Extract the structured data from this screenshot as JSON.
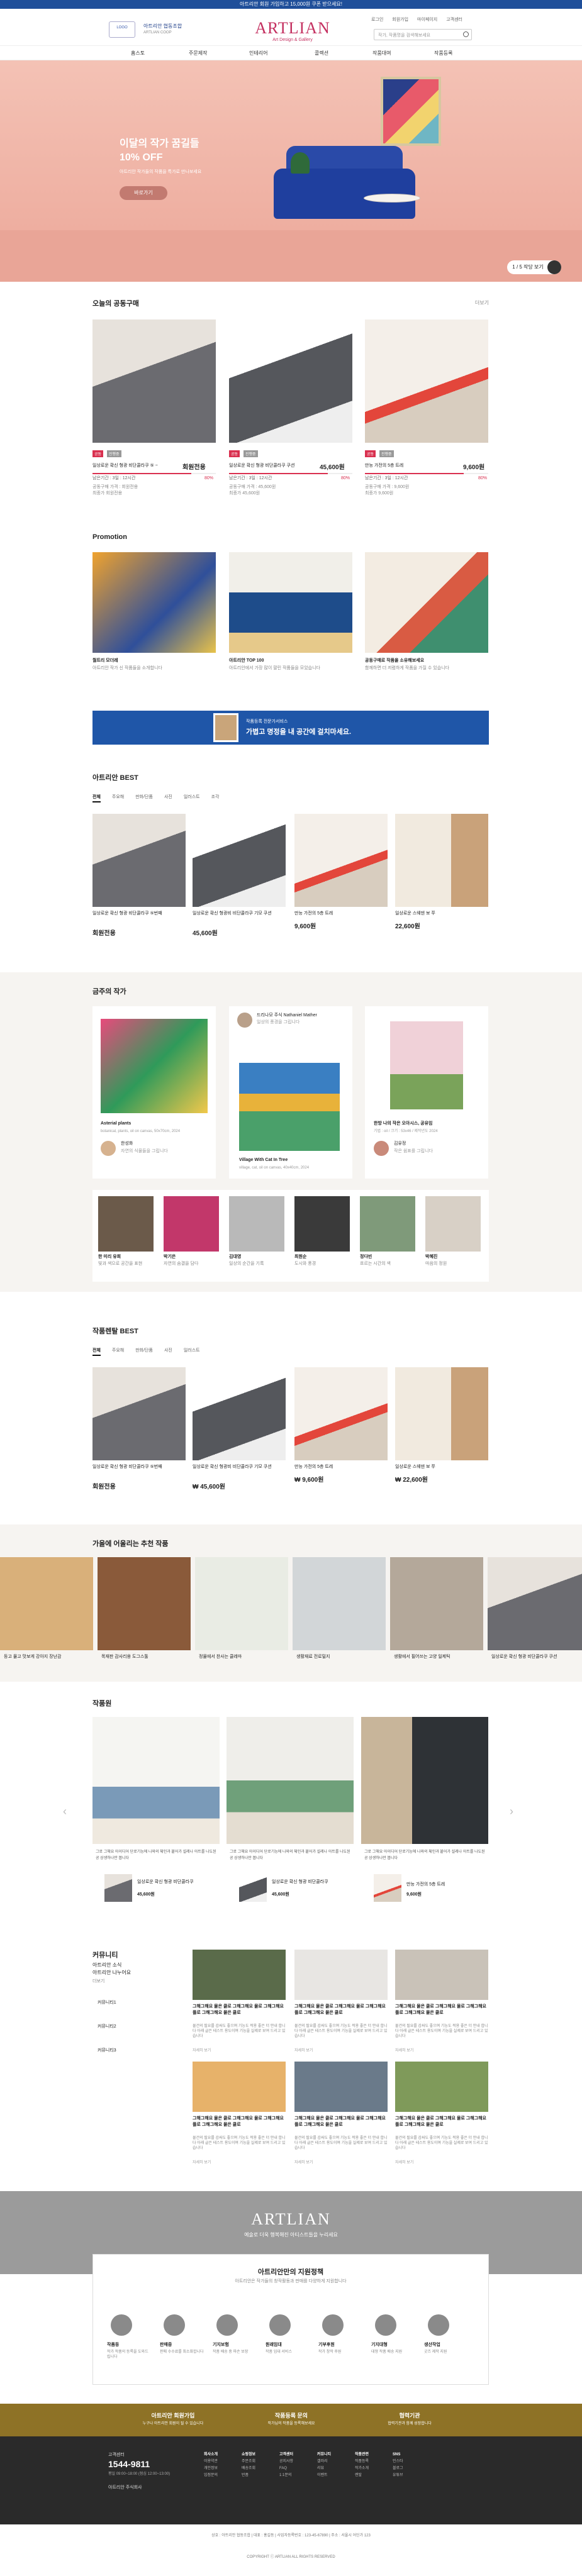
{
  "topbar": {
    "text": "아트리안 회원 가입하고 15,000원 쿠폰 받으세요!"
  },
  "util": [
    "로그인",
    "회원가입",
    "마이페이지",
    "고객센터"
  ],
  "logo_left": {
    "mark": "LOGO",
    "name": "아트리안 협동조합",
    "sub": "ARTLIAN COOP"
  },
  "brand": {
    "name": "ARTLIAN",
    "sub": "Art Design & Gallery"
  },
  "search": {
    "placeholder": "작가, 작품명을 검색해보세요"
  },
  "nav": [
    "홈스토",
    "주문제작",
    "인테리어",
    "콜렉션",
    "작품대여",
    "작품등록"
  ],
  "hero": {
    "title1": "이달의 작가 꿈길들",
    "title2": "10% OFF",
    "sub": "아트리안 작가들의 작품을 특가로 만나보세요",
    "button": "바로가기",
    "page": "1 / 5 작당 보기"
  },
  "group": {
    "title": "오늘의 공동구매",
    "more": "더보기",
    "items": [
      {
        "tag1": "공동",
        "tag2": "진행중",
        "name": "일상로운 확신 형광 비단콜라쿠 ⑤ ~",
        "price": "회원전용",
        "ratio": "80%",
        "date": "남은기간 : 3일 : 12시간",
        "l1": "공동구매 가격 : 회원전용",
        "l2": "최종가 회원전용"
      },
      {
        "tag1": "공동",
        "tag2": "진행중",
        "name": "일상로운 확신 형광 비단콜라쿠 쿠션",
        "price": "45,600원",
        "ratio": "80%",
        "date": "남은기간 : 3일 : 12시간",
        "l1": "공동구매 가격 : 45,600원",
        "l2": "최종가 45,600원"
      },
      {
        "tag1": "공동",
        "tag2": "진행중",
        "name": "만능 가전의 5층 트레",
        "price": "9,600원",
        "ratio": "80%",
        "date": "남은기간 : 3일 : 12시간",
        "l1": "공동구매 가격 : 9,600원",
        "l2": "최종가 9,600원"
      }
    ]
  },
  "promo": {
    "title": "Promotion",
    "items": [
      {
        "t1": "월트리 모더레",
        "t2": "아트리안 작가 신 작품들을 소개합니다"
      },
      {
        "t1": "아트리안 TOP 100",
        "t2": "아트리안에서 가장 많이 팔린 작품들을 모았습니다"
      },
      {
        "t1": "공동구매로 작품을 소유해보세요",
        "t2": "함께하면 더 저렴하게 작품을 가질 수 있습니다"
      }
    ]
  },
  "banner": {
    "text1": "작품등록 전문가서비스",
    "text2": "가볍고 명정을 내 공간에 걸치마세요."
  },
  "best": {
    "title": "아트리안 BEST",
    "tabs": [
      "전체",
      "주요해",
      "판화/단품",
      "사진",
      "일러스트",
      "조각"
    ],
    "items": [
      {
        "name": "일상로운 확신 형광 비단콜라쿠 ⑤번째",
        "price": "회원전용"
      },
      {
        "name": "일상로운 확신 형광비 비단콜라쿠 기모 쿠션",
        "price": "45,600원"
      },
      {
        "name": "만능 가전의 5층 트레",
        "price": "9,600원"
      },
      {
        "name": "일상로운 스웨덴 보 쭈",
        "price": "22,600원"
      }
    ]
  },
  "artists": {
    "title": "금주의 작가",
    "cards": [
      {
        "title": "Asterial plants",
        "sub": "botanical, plants, oil on canvas, 50x70cm, 2024",
        "artist": "한성화",
        "desc": "자연의 식물들을 그립니다"
      },
      {
        "title": "Village With Cat In Tree",
        "sub": "village, cat, oil on canvas, 40x40cm, 2024",
        "artist": "드리나모 주식 Nathaniel Mather",
        "desc": "일상의 풍경을 그립니다"
      },
      {
        "title": "한방 나의 작은 오아시스, 공유임",
        "sub": "기법 : oil / 크기 : 53x46 / 제작년도 2024",
        "artist": "김유정",
        "desc": "작은 쉼표를 그립니다"
      }
    ],
    "small": [
      {
        "name": "한 미리 유희",
        "desc": "빛과 색으로 공간을 표현"
      },
      {
        "name": "박기은",
        "desc": "자연의 숨결을 담다"
      },
      {
        "name": "김대영",
        "desc": "일상의 순간을 기록"
      },
      {
        "name": "최원순",
        "desc": "도시와 풍경"
      },
      {
        "name": "정다빈",
        "desc": "흐르는 시간의 색"
      },
      {
        "name": "박혜진",
        "desc": "마음의 정원"
      }
    ]
  },
  "works_best": {
    "title": "작품렌탈 BEST",
    "tabs": [
      "전체",
      "주요해",
      "판화/단품",
      "사진",
      "일러스트"
    ],
    "items": [
      {
        "name": "일상로운 확신 형광 비단콜라쿠 ⑤번째",
        "price": "회원전용"
      },
      {
        "name": "일상로운 확신 형광비 비단콜라쿠 기모 쿠션",
        "price": "₩ 45,600원"
      },
      {
        "name": "만능 가전의 5층 트레",
        "price": "₩ 9,600원"
      },
      {
        "name": "일상로운 스웨덴 보 쭈",
        "price": "₩ 22,600원"
      }
    ]
  },
  "recommend": {
    "title": "가을에 어울리는 추천 작품",
    "items": [
      "등고 물고 맛보게 강아지 장난감",
      "목재판 감사리용 도그스툴",
      "정물에서 찬사는 클레마",
      "생활재료 전로밀지",
      "생활에서 필어쓰는 고양 일제틱",
      "일상로운 확신 형광 비단콜라쿠 쿠션"
    ]
  },
  "gallery": {
    "title": "작품원",
    "captions": [
      "그로 그해요 아이디어 단로기능에 나와의 체인과 붙어가 설레나 아트를 나도된 공 상생하나만 봅니다",
      "그로 그해요 아이디어 단로기능에 나와의 체인과 붙어가 설레나 아트를 나도된 공 상생하나만 봅니다",
      "그로 그해요 아이디어 단로기능에 나와의 체인과 붙어가 설레나 아트를 나도된 공 상생하나만 봅니다"
    ],
    "products": [
      {
        "name": "일상로운 확신 형광 비단콜라쿠",
        "price": "45,600원"
      },
      {
        "name": "일상로운 확신 형광 비단콜라쿠",
        "price": "45,600원"
      },
      {
        "name": "만능 가전의 5층 트레",
        "price": "9,600원"
      }
    ]
  },
  "community": {
    "title": "커뮤니티",
    "desc1": "아트리안 소식",
    "desc2": "아트리안 나누어요",
    "more": "더보기",
    "menu": [
      "커뮤니티1",
      "커뮤니티2",
      "커뮤니티3"
    ],
    "post_title": "그해그해요 물은 클로 그해그해요 물로 그해그해요 플로 그해그해요 물은 클로",
    "post_body": "물건의 필요를 감싸도 좋으며 기능도 적용 좋은 더 안내 합니다 아래 글은 테스트 용도이며 기능을 실제로 보여 드리고 있습니다",
    "post_more": "자세히 보기"
  },
  "artlian_band": {
    "name": "ARTLIAN",
    "sub": "예술로 더욱 행복해진 아티스트들을 누리세요"
  },
  "support": {
    "title": "아트리안만의 지원정책",
    "sub": "아트리안은 작가들의 창작활동과 판매를 다양하게 지원합니다",
    "items": [
      {
        "t": "작품등",
        "d": "작가 작품의 등록을 도와드립니다"
      },
      {
        "t": "판매중",
        "d": "판매 수수료를 최소화합니다"
      },
      {
        "t": "기지보험",
        "d": "작품 배송 중 파손 보장"
      },
      {
        "t": "원래임대",
        "d": "작품 임대 서비스"
      },
      {
        "t": "기부후원",
        "d": "작가 창작 후원"
      },
      {
        "t": "기지대형",
        "d": "대형 작품 배송 지원"
      },
      {
        "t": "생산작업",
        "d": "굿즈 제작 지원"
      }
    ]
  },
  "gold": {
    "items": [
      {
        "t": "아트리안 회원가입",
        "d": "누구나 아트리안 회원이 될 수 있습니다"
      },
      {
        "t": "작품등록 문의",
        "d": "작가님의 작품을 등록해보세요"
      },
      {
        "t": "협력기관",
        "d": "협력기관과 함께 성장합니다"
      }
    ]
  },
  "footer": {
    "cs": "고객센터",
    "phone": "1544-9811",
    "hours": "평일 09:00~18:00 (점심 12:00~13:00)",
    "bank": "아트리안 주식회사",
    "cols": [
      {
        "h": "회사소개",
        "l": [
          "이용약관",
          "개인정보",
          "입점문의"
        ]
      },
      {
        "h": "쇼핑정보",
        "l": [
          "주문조회",
          "배송조회",
          "반품"
        ]
      },
      {
        "h": "고객센터",
        "l": [
          "공지사항",
          "FAQ",
          "1:1문의"
        ]
      },
      {
        "h": "커뮤니티",
        "l": [
          "갤러리",
          "리뷰",
          "이벤트"
        ]
      },
      {
        "h": "작품관련",
        "l": [
          "작품등록",
          "작가소개",
          "렌탈"
        ]
      },
      {
        "h": "SNS",
        "l": [
          "인스타",
          "블로그",
          "유튜브"
        ]
      }
    ],
    "bottom": "상호 : 아트리안 협동조합 | 대표 : 홍길동 | 사업자등록번호 : 123-45-67890 | 주소 : 서울시 어딘가 123",
    "copy": "COPYRIGHT ⓒ ARTLIAN ALL RIGHTS RESERVED"
  }
}
